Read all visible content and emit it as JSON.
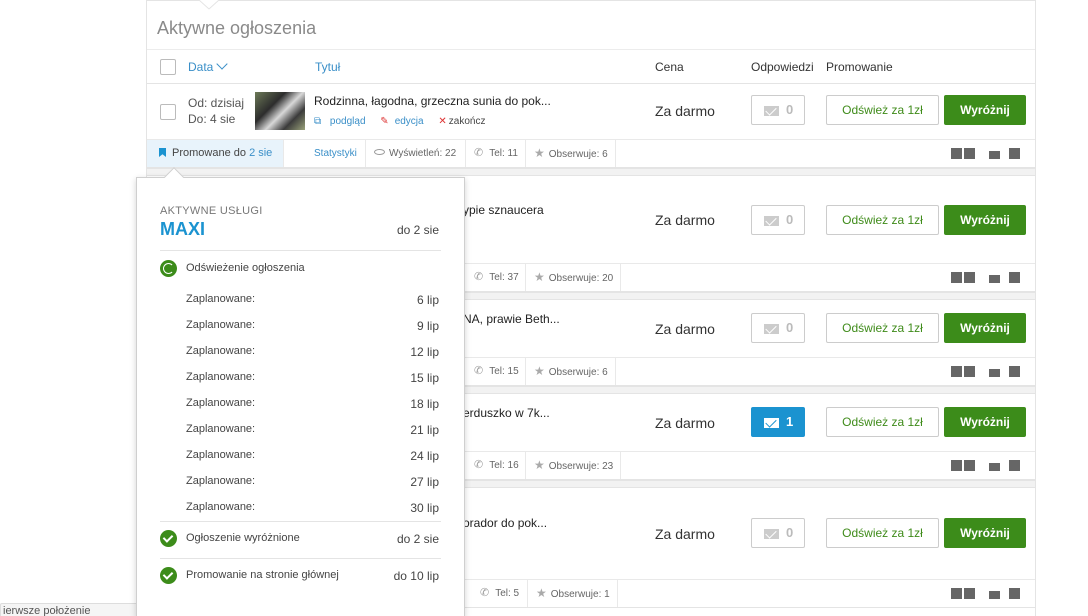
{
  "panel": {
    "title": "Aktywne ogłoszenia"
  },
  "columns": {
    "date": "Data",
    "title": "Tytuł",
    "price": "Cena",
    "replies": "Odpowiedzi",
    "promotion": "Promowanie"
  },
  "listings": [
    {
      "from": "Od: dzisiaj",
      "to": "Do: 4 sie",
      "title": "Rodzinna, łagodna, grzeczna sunia do pok...",
      "actions": {
        "preview": "podgląd",
        "edit": "edycja",
        "end": "zakończ"
      },
      "price": "Za darmo",
      "replies": "0",
      "refresh_label": "Odśwież za 1zł",
      "feature_label": "Wyróżnij",
      "promo_prefix": "Promowane do",
      "promo_date": "2 sie",
      "stats_label": "Statystyki",
      "views": "Wyświetleń: 22",
      "phone": "Tel: 11",
      "watch": "Obserwuje: 6"
    },
    {
      "title": "ypie sznaucera",
      "price": "Za darmo",
      "replies": "0",
      "refresh_label": "Odśwież za 1zł",
      "feature_label": "Wyróżnij",
      "phone": "Tel: 37",
      "watch": "Obserwuje: 20"
    },
    {
      "title": "NA, prawie Beth...",
      "price": "Za darmo",
      "replies": "0",
      "refresh_label": "Odśwież za 1zł",
      "feature_label": "Wyróżnij",
      "phone": "Tel: 15",
      "watch": "Obserwuje: 6"
    },
    {
      "title": "erduszko w 7k...",
      "price": "Za darmo",
      "replies": "1",
      "refresh_label": "Odśwież za 1zł",
      "feature_label": "Wyróżnij",
      "phone": "Tel: 16",
      "watch": "Obserwuje: 23"
    },
    {
      "title": "orador do pok...",
      "price": "Za darmo",
      "replies": "0",
      "refresh_label": "Odśwież za 1zł",
      "feature_label": "Wyróżnij",
      "phone": "Tel: 5",
      "watch": "Obserwuje: 1"
    }
  ],
  "popover": {
    "subtitle": "AKTYWNE USŁUGI",
    "package": "MAXI",
    "package_until": "do 2 sie",
    "refresh_service": "Odświeżenie ogłoszenia",
    "schedule": [
      {
        "label": "Zaplanowane:",
        "date": "6 lip"
      },
      {
        "label": "Zaplanowane:",
        "date": "9 lip"
      },
      {
        "label": "Zaplanowane:",
        "date": "12 lip"
      },
      {
        "label": "Zaplanowane:",
        "date": "15 lip"
      },
      {
        "label": "Zaplanowane:",
        "date": "18 lip"
      },
      {
        "label": "Zaplanowane:",
        "date": "21 lip"
      },
      {
        "label": "Zaplanowane:",
        "date": "24 lip"
      },
      {
        "label": "Zaplanowane:",
        "date": "27 lip"
      },
      {
        "label": "Zaplanowane:",
        "date": "30 lip"
      }
    ],
    "featured_service": "Ogłoszenie wyróżnione",
    "featured_until": "do 2 sie",
    "homepage_service": "Promowanie na stronie głównej",
    "homepage_until": "do 10 lip"
  },
  "tooltip": {
    "text": "ierwsze położenie"
  }
}
